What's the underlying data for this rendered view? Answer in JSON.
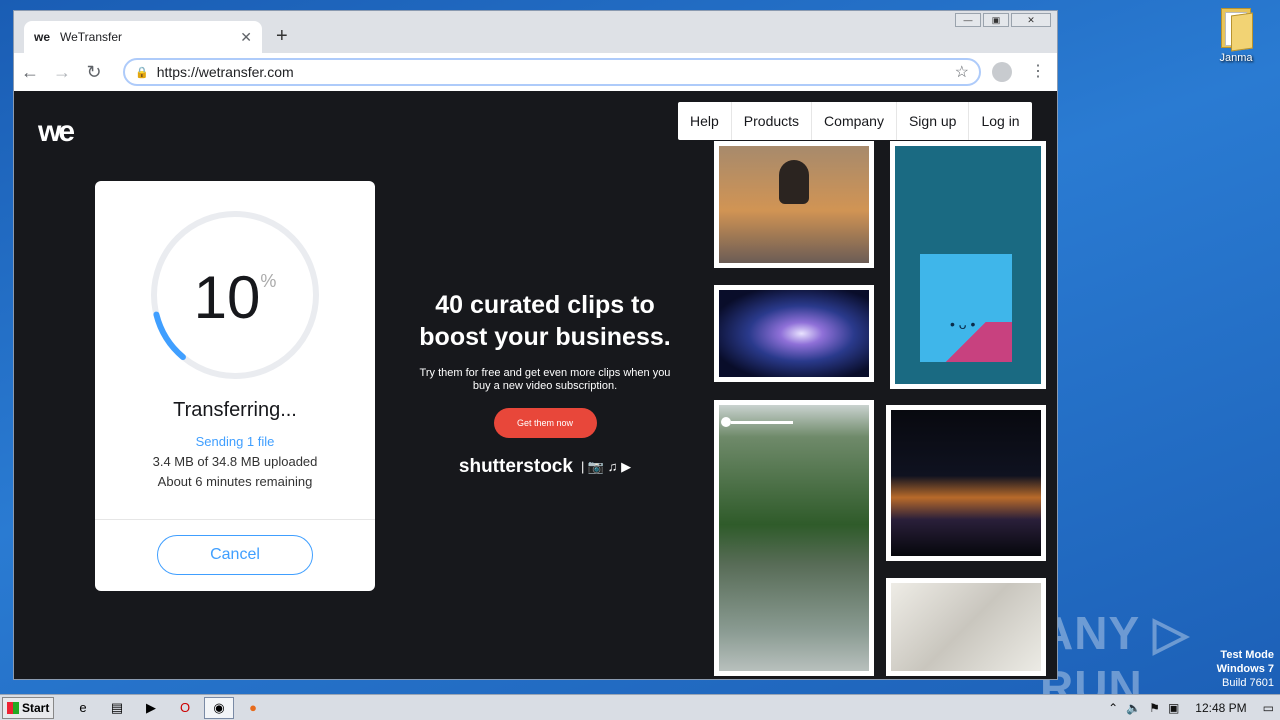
{
  "browser": {
    "tab_title": "WeTransfer",
    "tab_favicon_text": "we",
    "url": "https://wetransfer.com",
    "window_controls": {
      "minimize": "—",
      "restore": "▣",
      "close": "✕"
    }
  },
  "site": {
    "logo_text": "we",
    "nav": {
      "help": "Help",
      "products": "Products",
      "company": "Company",
      "signup": "Sign up",
      "login": "Log in"
    }
  },
  "transfer": {
    "percent": "10",
    "percent_sign": "%",
    "progress_fraction": 0.1,
    "status": "Transferring...",
    "sending": "Sending 1 file",
    "uploaded": "3.4 MB of 34.8 MB uploaded",
    "remaining": "About 6 minutes remaining",
    "cancel_label": "Cancel",
    "accent_color": "#409fff"
  },
  "ad": {
    "headline": "40 curated clips to boost your business.",
    "body": "Try them for free and get even more clips when you buy a new video subscription.",
    "cta": "Get them now",
    "brand": "shutterstock",
    "brand_symbols": "| 📷 ♫ ▶",
    "cta_color": "#e8473a"
  },
  "desktop": {
    "icon_label": "Janma",
    "watermark": "ANY ▷ RUN",
    "test_mode_line1": "Test Mode",
    "test_mode_line2": "Windows 7",
    "test_mode_line3": "Build 7601"
  },
  "taskbar": {
    "start_label": "Start",
    "clock": "12:48 PM"
  }
}
